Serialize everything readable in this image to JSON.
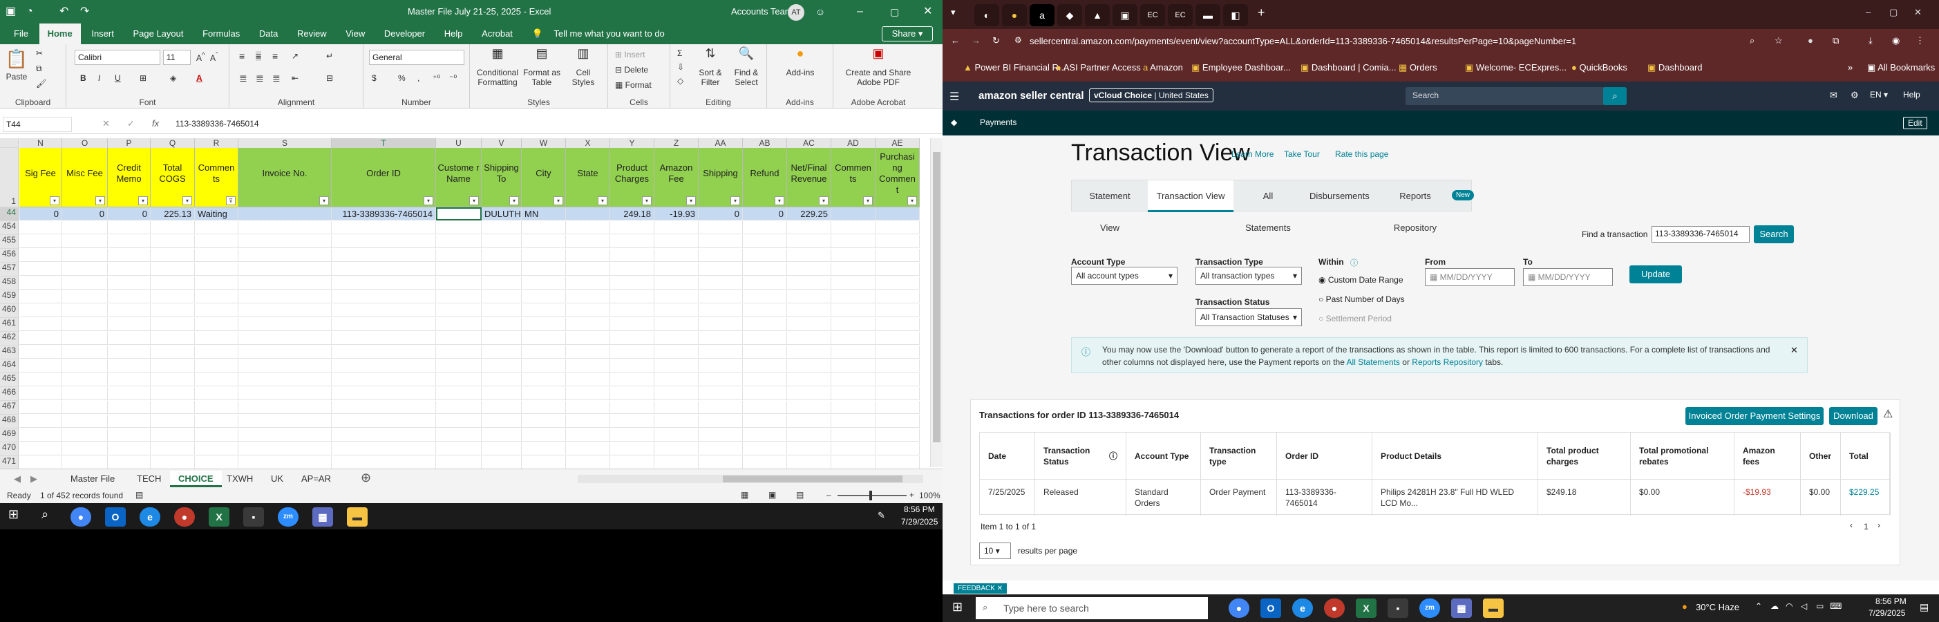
{
  "excel": {
    "title": "Master File July 21-25, 2025  -  Excel",
    "account": "Accounts Team",
    "account_initials": "AT",
    "share_label": "Share",
    "search_label": "Tell me what you want to do",
    "tabs": [
      "File",
      "Home",
      "Insert",
      "Page Layout",
      "Formulas",
      "Data",
      "Review",
      "View",
      "Developer",
      "Help",
      "Acrobat"
    ],
    "ribbon": {
      "clipboard": {
        "label": "Clipboard",
        "paste": "Paste"
      },
      "font": {
        "label": "Font",
        "name": "Calibri",
        "size": "11"
      },
      "alignment": {
        "label": "Alignment"
      },
      "number": {
        "label": "Number",
        "format": "General",
        "currency": "$",
        "percent": "%",
        "comma": ","
      },
      "styles": {
        "label": "Styles",
        "items": [
          "Conditional Formatting",
          "Format as Table",
          "Cell Styles"
        ]
      },
      "cells": {
        "label": "Cells",
        "insert": "Insert",
        "delete": "Delete",
        "format": "Format"
      },
      "editing": {
        "label": "Editing",
        "sort": "Sort & Filter",
        "find": "Find & Select"
      },
      "addins": {
        "label": "Add-ins",
        "button": "Add-ins"
      },
      "acrobat": {
        "label": "Adobe Acrobat",
        "button": "Create and Share Adobe PDF"
      }
    },
    "namebox": "T44",
    "formula_fx": "fx",
    "formula": "113-3389336-7465014",
    "columns": [
      {
        "letter": "N",
        "header": "Sig Fee",
        "w": 62,
        "color": "#ffff00"
      },
      {
        "letter": "O",
        "header": "Misc Fee",
        "w": 66,
        "color": "#ffff00"
      },
      {
        "letter": "P",
        "header": "Credit Memo",
        "w": 62,
        "color": "#ffff00"
      },
      {
        "letter": "Q",
        "header": "Total COGS",
        "w": 64,
        "color": "#ffff00"
      },
      {
        "letter": "R",
        "header": "Commen ts",
        "w": 63,
        "color": "#ffff00"
      },
      {
        "letter": "S",
        "header": "Invoice No.",
        "w": 135,
        "color": "#92d050"
      },
      {
        "letter": "T",
        "header": "Order ID",
        "w": 151,
        "color": "#92d050"
      },
      {
        "letter": "U",
        "header": "Custome r Name",
        "w": 66,
        "color": "#92d050"
      },
      {
        "letter": "V",
        "header": "Shipping To",
        "w": 58,
        "color": "#92d050"
      },
      {
        "letter": "W",
        "header": "City",
        "w": 64,
        "color": "#92d050"
      },
      {
        "letter": "X",
        "header": "State",
        "w": 64,
        "color": "#92d050"
      },
      {
        "letter": "Y",
        "header": "Product Charges",
        "w": 64,
        "color": "#92d050"
      },
      {
        "letter": "Z",
        "header": "Amazon Fee",
        "w": 64,
        "color": "#92d050"
      },
      {
        "letter": "AA",
        "header": "Shipping",
        "w": 64,
        "color": "#92d050"
      },
      {
        "letter": "AB",
        "header": "Refund",
        "w": 64,
        "color": "#92d050"
      },
      {
        "letter": "AC",
        "header": "Net/Final Revenue",
        "w": 64,
        "color": "#92d050"
      },
      {
        "letter": "AD",
        "header": "Commen ts",
        "w": 64,
        "color": "#92d050"
      },
      {
        "letter": "AE",
        "header": "Purchasi ng Commen t",
        "w": 64,
        "color": "#92d050"
      }
    ],
    "header_row": "1",
    "data_row": {
      "num": "44",
      "cells": [
        "0",
        "0",
        "0",
        "225.13",
        "Waiting",
        "",
        "113-3389336-7465014",
        "",
        "DULUTH",
        "MN",
        "",
        "249.18",
        "-19.93",
        "0",
        "0",
        "229.25",
        "",
        ""
      ]
    },
    "empty_rows": [
      "454",
      "455",
      "456",
      "457",
      "458",
      "459",
      "460",
      "461",
      "462",
      "463",
      "464",
      "465",
      "466",
      "467",
      "468",
      "469",
      "470",
      "471"
    ],
    "sheets": [
      "Master File",
      "TECH",
      "CHOICE",
      "TXWH",
      "UK",
      "AP=AR"
    ],
    "active_sheet": "CHOICE",
    "status": "Ready",
    "records": "1 of 452 records found",
    "zoom": "100%"
  },
  "taskbar_left": {
    "time": "8:56 PM",
    "date": "7/29/2025"
  },
  "browser": {
    "url": "sellercentral.amazon.com/payments/event/view?accountType=ALL&orderId=113-3389336-7465014&resultsPerPage=10&pageNumber=1",
    "bookmarks": [
      "Power BI Financial R...",
      "ASI Partner Access",
      "Amazon",
      "Employee Dashboar...",
      "Dashboard | Comia...",
      "Orders",
      "Welcome- ECExpres...",
      "QuickBooks",
      "Dashboard"
    ],
    "all_bookmarks": "All Bookmarks",
    "amazon": {
      "logo": "amazon seller central",
      "store": "vCloud Choice",
      "region": "United States",
      "search_placeholder": "Search",
      "lang": "EN",
      "help": "Help",
      "breadcrumb": "Payments",
      "edit": "Edit",
      "page_title": "Transaction View",
      "learn_more": "Learn More",
      "take_tour": "Take Tour",
      "rate_page": "Rate this page",
      "view_tabs": [
        "Statement View",
        "Transaction View",
        "All Statements",
        "Disbursements",
        "Reports Repository"
      ],
      "new_badge": "New",
      "find_label": "Find a transaction",
      "find_value": "113-3389336-7465014",
      "search_btn": "Search",
      "account_type_label": "Account Type",
      "account_type_value": "All account types",
      "transaction_type_label": "Transaction Type",
      "transaction_type_value": "All transaction types",
      "transaction_status_label": "Transaction Status",
      "transaction_status_value": "All Transaction Statuses",
      "within_label": "Within",
      "within_options": [
        "Custom Date Range",
        "Past Number of Days",
        "Settlement Period"
      ],
      "from_label": "From",
      "to_label": "To",
      "date_placeholder": "MM/DD/YYYY",
      "update_btn": "Update",
      "info_text": "You may now use the 'Download' button to generate a report of the transactions as shown in the table. This report is limited to 600 transactions. For a complete list of transactions and other columns not displayed here, use the Payment reports on the",
      "info_link1": "All Statements",
      "info_or": "or",
      "info_link2": "Reports Repository",
      "info_tabs": "tabs.",
      "table_title": "Transactions for order ID 113-3389336-7465014",
      "invoiced_btn": "Invoiced Order Payment Settings",
      "download_btn": "Download",
      "headers": [
        "Date",
        "Transaction Status",
        "Account Type",
        "Transaction type",
        "Order ID",
        "Product Details",
        "Total product charges",
        "Total promotional rebates",
        "Amazon fees",
        "Other",
        "Total"
      ],
      "row": [
        "7/25/2025",
        "Released",
        "Standard Orders",
        "Order Payment",
        "113-3389336-7465014",
        "Philips 24281H 23.8\" Full HD WLED LCD Mo...",
        "$249.18",
        "$0.00",
        "-$19.93",
        "$0.00",
        "$229.25"
      ],
      "item_count": "Item 1 to 1 of 1",
      "page_num": "1",
      "per_page": "10",
      "per_page_label": "results per page",
      "feedback": "FEEDBACK"
    }
  },
  "taskbar_right": {
    "search_placeholder": "Type here to search",
    "weather": "30°C  Haze",
    "time": "8:56 PM",
    "date": "7/29/2025"
  }
}
